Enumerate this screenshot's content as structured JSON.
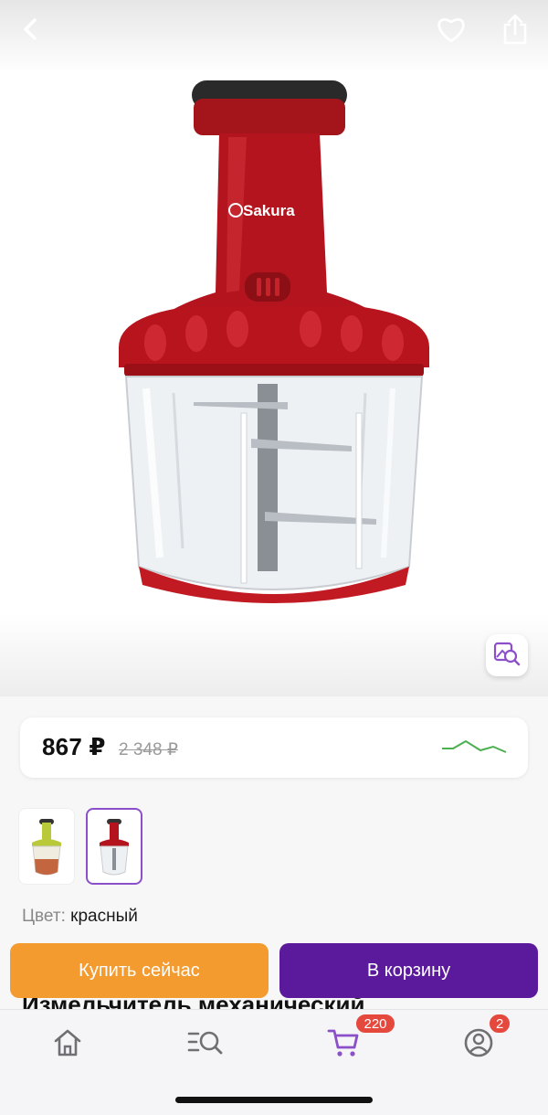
{
  "header": {
    "back_icon": "chevron-left-icon",
    "favorite_icon": "heart-icon",
    "share_icon": "share-icon"
  },
  "product": {
    "brand_on_image": "Sakura",
    "title_partial": "Измельчитель механический",
    "image_alt_icon": "visual-search-icon"
  },
  "price": {
    "current": "867 ₽",
    "old": "2 348 ₽",
    "trend_color": "#4caf50"
  },
  "variants": [
    {
      "name": "green",
      "selected": false
    },
    {
      "name": "red",
      "selected": true
    }
  ],
  "color": {
    "label": "Цвет:",
    "value": "красный"
  },
  "actions": {
    "buy_now": "Купить сейчас",
    "add_to_cart": "В корзину",
    "buy_color": "#f39b2f",
    "cart_color": "#5b1a9c"
  },
  "nav": {
    "items": [
      {
        "name": "home",
        "icon": "home-icon"
      },
      {
        "name": "catalog",
        "icon": "catalog-search-icon"
      },
      {
        "name": "cart",
        "icon": "cart-icon",
        "badge": "220"
      },
      {
        "name": "profile",
        "icon": "profile-icon",
        "badge": "2"
      }
    ],
    "active_color": "#8b4fc9"
  }
}
